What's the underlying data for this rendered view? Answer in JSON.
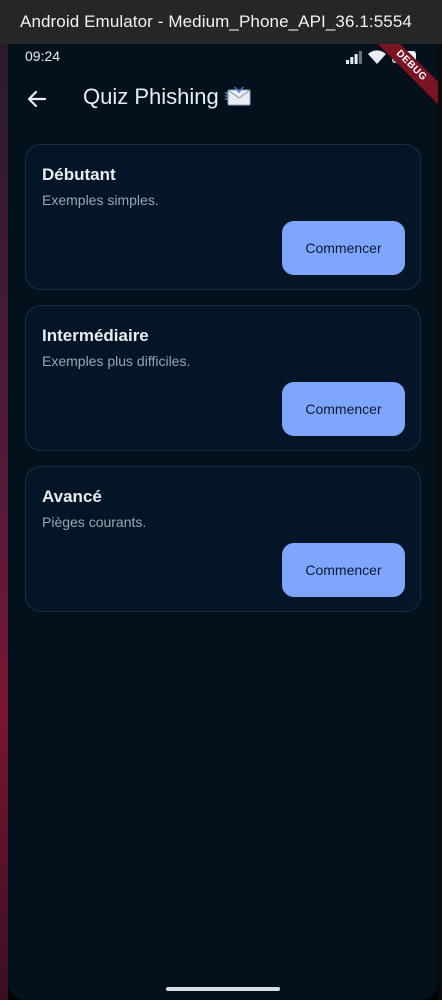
{
  "window": {
    "title": "Android Emulator - Medium_Phone_API_36.1:5554"
  },
  "statusbar": {
    "time": "09:24",
    "debug_label": "DEBUG"
  },
  "appbar": {
    "title": "Quiz Phishing",
    "title_icon": "incoming-envelope-icon",
    "back_icon": "arrow-left-icon"
  },
  "levels": [
    {
      "title": "Débutant",
      "description": "Exemples simples.",
      "button_label": "Commencer"
    },
    {
      "title": "Intermédiaire",
      "description": "Exemples plus difficiles.",
      "button_label": "Commencer"
    },
    {
      "title": "Avancé",
      "description": "Pièges courants.",
      "button_label": "Commencer"
    }
  ],
  "colors": {
    "background": "#02111b",
    "card_background": "#031526",
    "card_border": "#1c2e3e",
    "button": "#7fa6ff",
    "debug_banner": "#7a1425"
  }
}
